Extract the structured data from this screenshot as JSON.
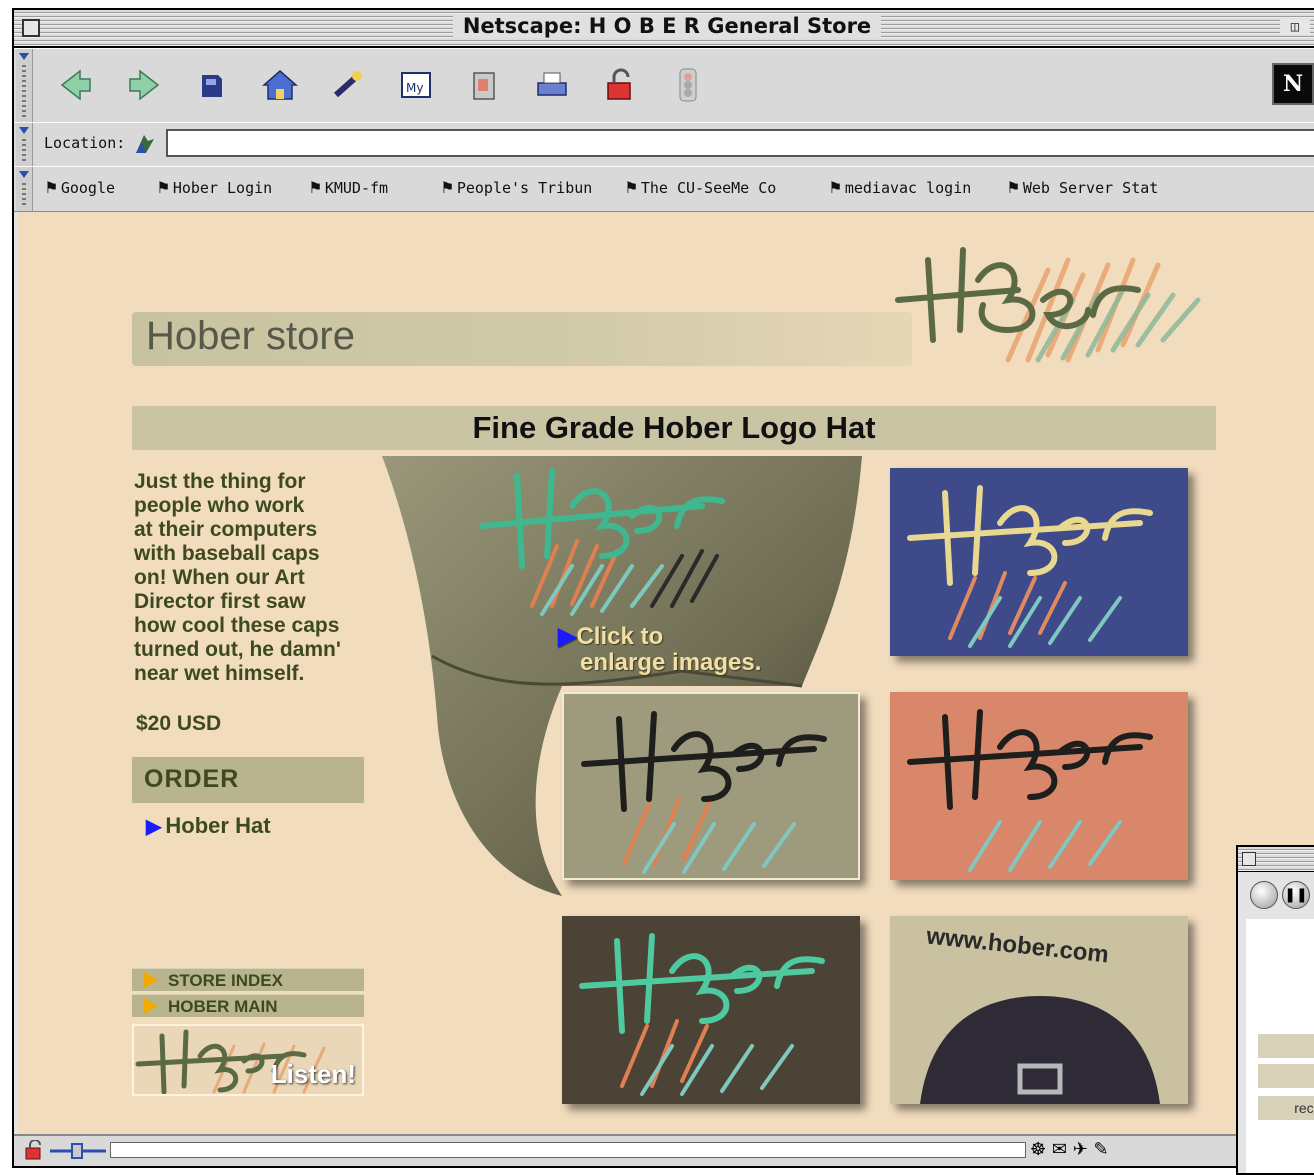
{
  "window": {
    "title": "Netscape: H O B E R General Store"
  },
  "toolbar": {
    "buttons": [
      {
        "name": "back",
        "icon": "back-arrow-icon"
      },
      {
        "name": "forward",
        "icon": "forward-arrow-icon"
      },
      {
        "name": "reload",
        "icon": "reload-icon"
      },
      {
        "name": "home",
        "icon": "home-icon"
      },
      {
        "name": "search",
        "icon": "search-icon"
      },
      {
        "name": "my-netscape",
        "icon": "my-netscape-icon"
      },
      {
        "name": "images",
        "icon": "images-icon"
      },
      {
        "name": "print",
        "icon": "print-icon"
      },
      {
        "name": "security",
        "icon": "security-lock-icon"
      },
      {
        "name": "stop",
        "icon": "stop-icon"
      }
    ],
    "throbber": "N"
  },
  "location": {
    "label": "Location:",
    "value": ""
  },
  "bookmarks": [
    {
      "label": "Google"
    },
    {
      "label": "Hober Login"
    },
    {
      "label": "KMUD-fm"
    },
    {
      "label": "People's Tribun"
    },
    {
      "label": "The CU-SeeMe Co"
    },
    {
      "label": "mediavac login"
    },
    {
      "label": "Web Server Stat"
    }
  ],
  "page": {
    "store_title": "Hober store",
    "product_title": "Fine Grade Hober Logo Hat",
    "description": "Just the thing for\npeople who work\nat their computers\nwith baseball caps\non! When our Art\nDirector first saw\nhow cool these caps\nturned out, he damn'\nnear wet himself.",
    "price": "$20 USD",
    "order_label": "ORDER",
    "order_link": "Hober Hat",
    "click_line1": "Click to",
    "click_line2": "enlarge images.",
    "store_index": "STORE INDEX",
    "hober_main": "HOBER MAIN",
    "listen": "Listen!",
    "url_text": "www.hober.com",
    "colors": {
      "background": "#f2dcbe",
      "bar": "#c9c4a3",
      "text_green": "#3d4a1f",
      "link_arrow": "#1a1aff",
      "nav_arrow": "#f2a900"
    }
  },
  "secondary_window": {
    "labels": [
      "l",
      "p",
      "rece r"
    ]
  }
}
